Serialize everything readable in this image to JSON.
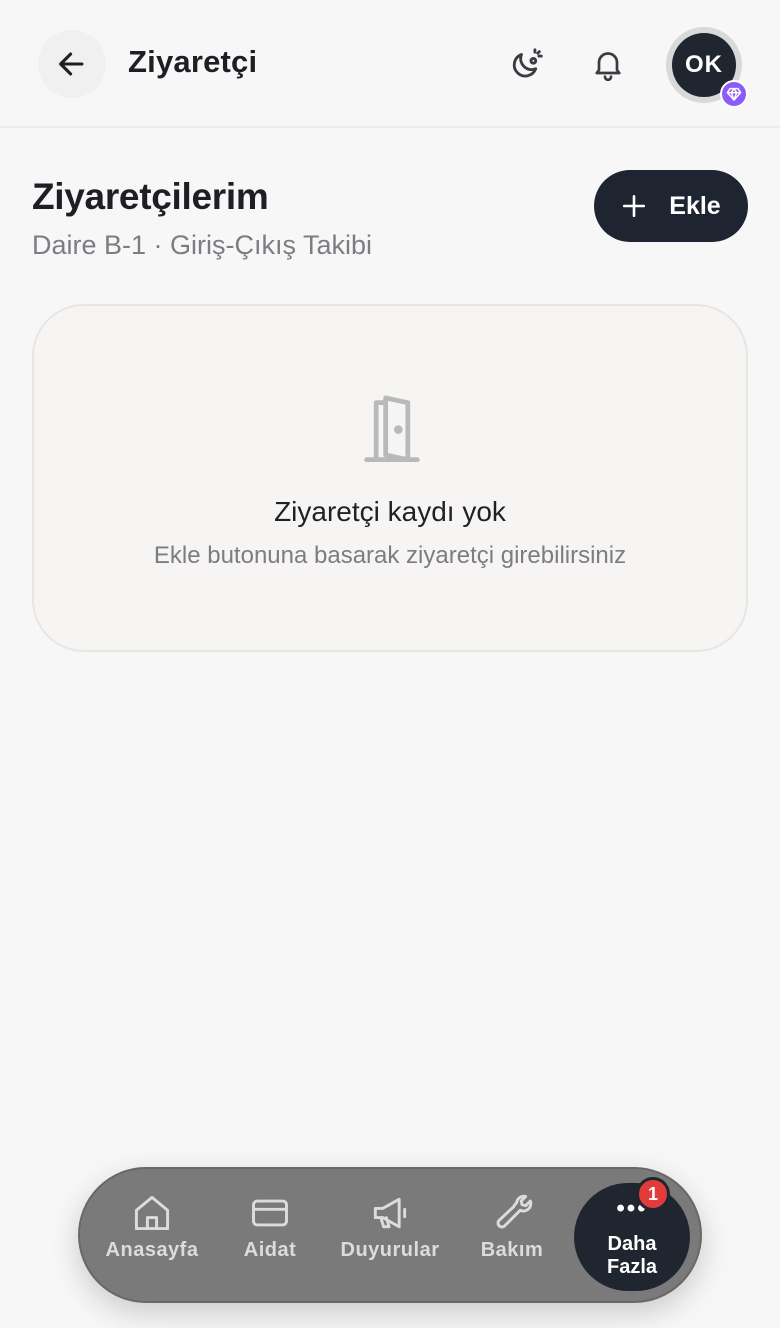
{
  "header": {
    "title": "Ziyaretçi",
    "avatar_initials": "OK"
  },
  "section": {
    "title": "Ziyaretçilerim",
    "subtitle": "Daire B-1 · Giriş-Çıkış Takibi",
    "add_label": "Ekle"
  },
  "empty_state": {
    "title": "Ziyaretçi kaydı yok",
    "subtitle": "Ekle butonuna basarak ziyaretçi girebilirsiniz"
  },
  "bottom_nav": {
    "items": [
      {
        "label": "Anasayfa",
        "icon": "home-icon"
      },
      {
        "label": "Aidat",
        "icon": "card-icon"
      },
      {
        "label": "Duyurular",
        "icon": "megaphone-icon"
      },
      {
        "label": "Bakım",
        "icon": "wrench-icon"
      }
    ],
    "more_line1": "Daha",
    "more_line2": "Fazla",
    "more_badge": "1"
  },
  "colors": {
    "background": "#f7f7f7",
    "dark": "#1e2530",
    "accent_purple": "#8b5cf6",
    "badge_red": "#e23b3b"
  }
}
